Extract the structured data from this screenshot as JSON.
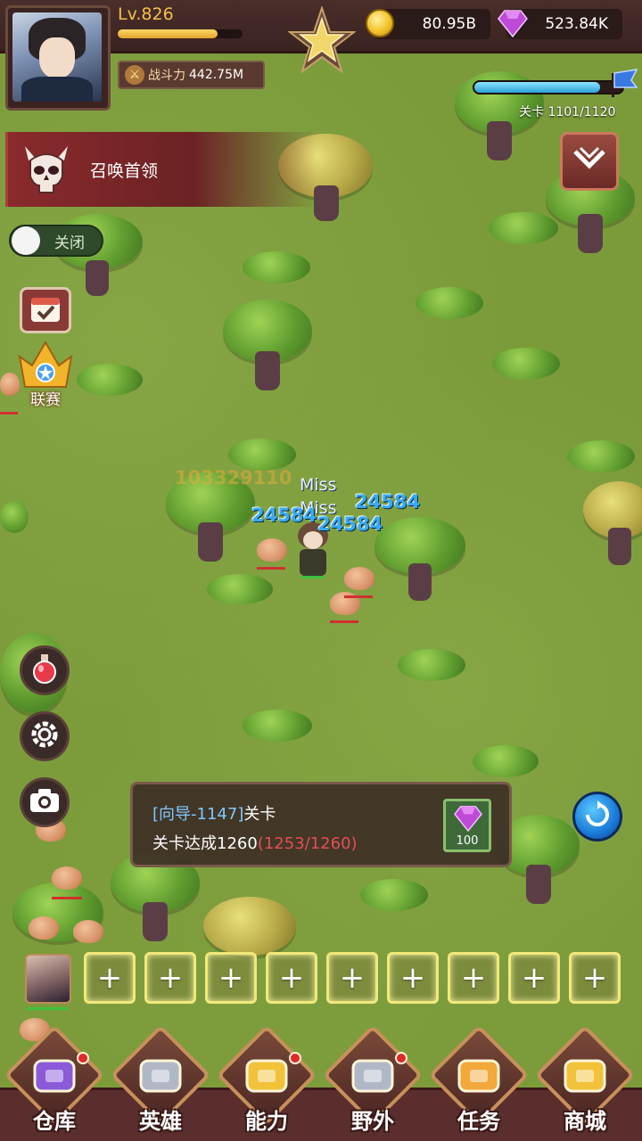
{
  "player": {
    "level": "Lv.826",
    "exp_fraction": 0.8,
    "power_label": "战斗力",
    "power_value": "442.75M"
  },
  "currency": {
    "gold": "80.95B",
    "gems": "523.84K"
  },
  "stage": {
    "label": "关卡 1101/1120",
    "progress_fraction": 0.85
  },
  "boss": {
    "label": "召唤首领"
  },
  "toggle": {
    "label": "关闭",
    "on": false
  },
  "league": {
    "label": "联赛"
  },
  "battle": {
    "damage_faded": "103329110",
    "miss_1": "Miss",
    "miss_2": "Miss",
    "damage_1": "24584",
    "damage_2": "24584",
    "damage_3": "24584"
  },
  "quest": {
    "tag": "[向导-1147]",
    "title": "关卡",
    "line2_prefix": "关卡达成1260",
    "line2_progress": "(1253/1260)",
    "reward_count": "100"
  },
  "slots": {
    "count": 9,
    "symbol": "+"
  },
  "nav": [
    {
      "label": "仓库",
      "icon": "warehouse-icon",
      "badge": true
    },
    {
      "label": "英雄",
      "icon": "hero-icon",
      "badge": false
    },
    {
      "label": "能力",
      "icon": "ability-icon",
      "badge": true
    },
    {
      "label": "野外",
      "icon": "field-icon",
      "badge": true
    },
    {
      "label": "任务",
      "icon": "quest-icon",
      "badge": false
    },
    {
      "label": "商城",
      "icon": "shop-icon",
      "badge": false
    }
  ],
  "colors": {
    "grass": "#7b9b3b",
    "frame": "#3a2320",
    "accent_gold": "#f0c24a",
    "damage_blue": "#3aaaf2",
    "alert_red": "#e05050"
  }
}
